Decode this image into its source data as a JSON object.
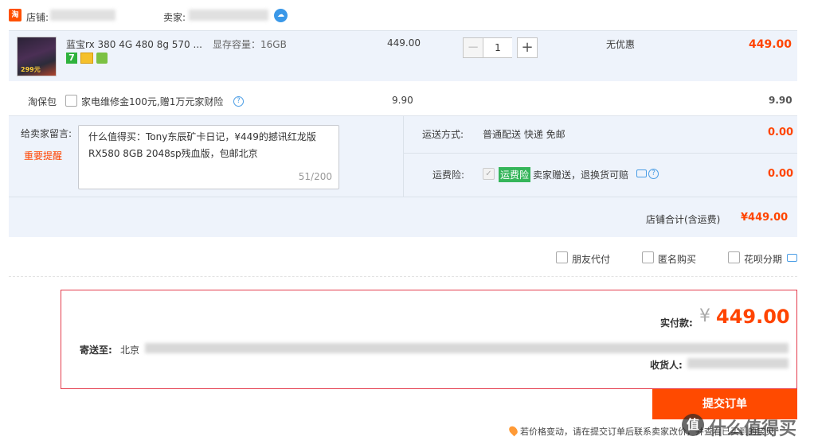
{
  "shop": {
    "logo_text": "淘",
    "shop_label": "店铺:",
    "shop_name": "██████",
    "seller_label": "卖家:",
    "seller_name": "████████████"
  },
  "item": {
    "title": "蓝宝rx 380 4G 480 8g 570 ...",
    "spec": "显存容量：16GB",
    "unit_price": "449.00",
    "quantity": "1",
    "discount": "无优惠",
    "subtotal": "449.00",
    "badge_7": "7",
    "thumb_tag": "299元"
  },
  "insurance_row": {
    "label": "淘保包",
    "option_text": "家电维修金100元,赠1万元家财险",
    "price": "9.90",
    "total": "9.90"
  },
  "message": {
    "label": "给卖家留言:",
    "reminder": "重要提醒",
    "content_line1": "什么值得买：Tony东辰矿卡日记，¥449的撼讯红龙版",
    "content_line2": "RX580 8GB 2048sp残血版，包邮北京",
    "counter": "51/200"
  },
  "shipping": {
    "label": "运送方式:",
    "value": "普通配送 快递 免邮",
    "price": "0.00"
  },
  "freight_insurance": {
    "label": "运费险:",
    "badge": "运费险",
    "text": "卖家赠送，退换货可赔",
    "price": "0.00"
  },
  "shop_total": {
    "label": "店铺合计(含运费)",
    "value": "¥449.00"
  },
  "options": {
    "friend_pay": "朋友代付",
    "anonymous": "匿名购买",
    "huabei": "花呗分期"
  },
  "summary": {
    "paid_label": "实付款:",
    "yen": "¥",
    "amount": "449.00",
    "ship_to_label": "寄送至:",
    "ship_to_city": "北京",
    "receiver_label": "收货人:"
  },
  "submit": {
    "label": "提交订单"
  },
  "notice": {
    "text": "若价格变动，请在提交订单后联系卖家改价，并查看已买到的宝贝"
  },
  "watermark": {
    "text": "什么值得买",
    "logo": "值"
  },
  "colors": {
    "accent": "#ff4400",
    "submit": "#ff4a00",
    "row_bg": "#eef3fb",
    "border_red": "#e43b4c",
    "badge_green": "#35b55a"
  }
}
